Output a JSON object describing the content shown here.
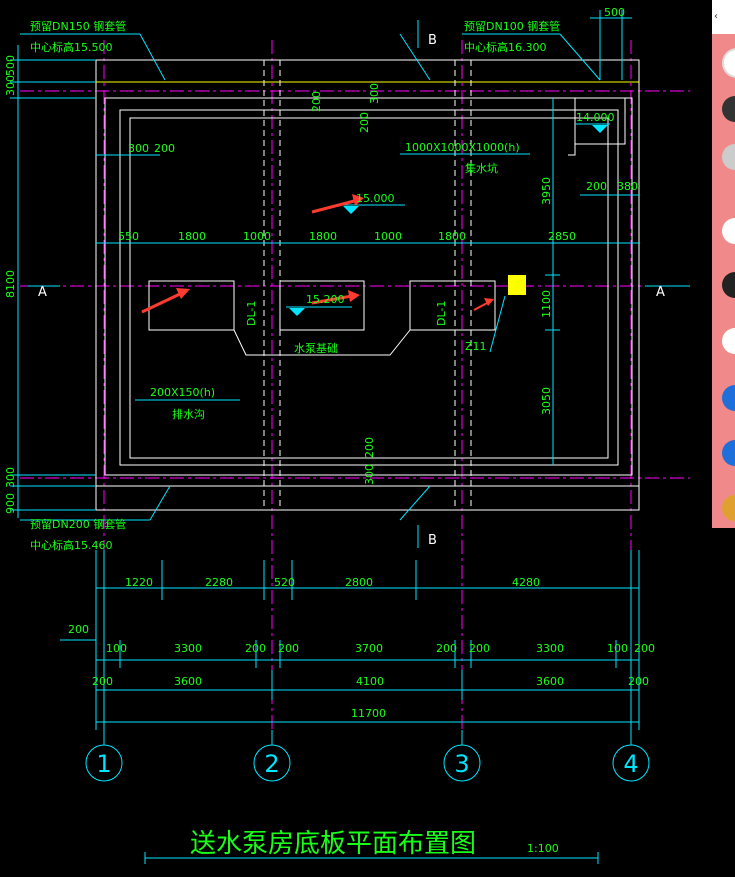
{
  "drawing": {
    "title": "送水泵房底板平面布置图",
    "scale": "1:100",
    "grid_axes": [
      "1",
      "2",
      "3",
      "4"
    ],
    "section_marks": {
      "a_left": "A",
      "a_right": "A",
      "b_top": "B",
      "b_bottom": "B"
    },
    "notes": {
      "pipe_dn150": "预留DN150 钢套管",
      "pipe_dn150_elev": "中心标高15.500",
      "pipe_dn100": "预留DN100 钢套管",
      "pipe_dn100_elev": "中心标高16.300",
      "pipe_dn200": "预留DN200 钢套管",
      "pipe_dn200_elev": "中心标高15.460",
      "sump_size": "1000X1000X1000(h)",
      "sump_name": "集水坑",
      "trench_size": "200X150(h)",
      "trench_name": "排水沟",
      "pump_base": "水泵基础",
      "beam_label": "DL-1",
      "column_label": "Z11"
    },
    "elevations": {
      "sump": "14.000",
      "slab": "15.000",
      "pump": "15.200"
    },
    "dims_top": {
      "d500": "500",
      "d300a": "300",
      "d200a": "200",
      "d300b": "300",
      "d200b": "200",
      "d380": "380"
    },
    "dims_left": {
      "v500": "500",
      "v300": "300",
      "v8100": "8100",
      "v300b": "300",
      "v900": "900"
    },
    "dims_right": {
      "v3950": "3950",
      "v1100": "1100",
      "v3050": "3050"
    },
    "dims_inner_h": [
      "550",
      "1800",
      "1000",
      "1800",
      "1000",
      "1800",
      "2850"
    ],
    "dims_inner_v": {
      "v200a": "200",
      "v300a": "300",
      "v200b": "200",
      "v300b": "300"
    },
    "dims_row1": [
      "1220",
      "2280",
      "520",
      "2800",
      "4280"
    ],
    "dims_row2_left": "200",
    "dims_row2": [
      "100",
      "3300",
      "200",
      "200",
      "3700",
      "200",
      "200",
      "3300",
      "100",
      "200"
    ],
    "dims_row3": [
      "200",
      "3600",
      "4100",
      "3600",
      "200"
    ],
    "dims_total": "11700"
  },
  "colors": {
    "green": "#19ff19",
    "cyan": "#00e5ff",
    "magenta": "#ff00ff",
    "white": "#ffffff",
    "yellow": "#ffff00",
    "red": "#ff3b30"
  }
}
